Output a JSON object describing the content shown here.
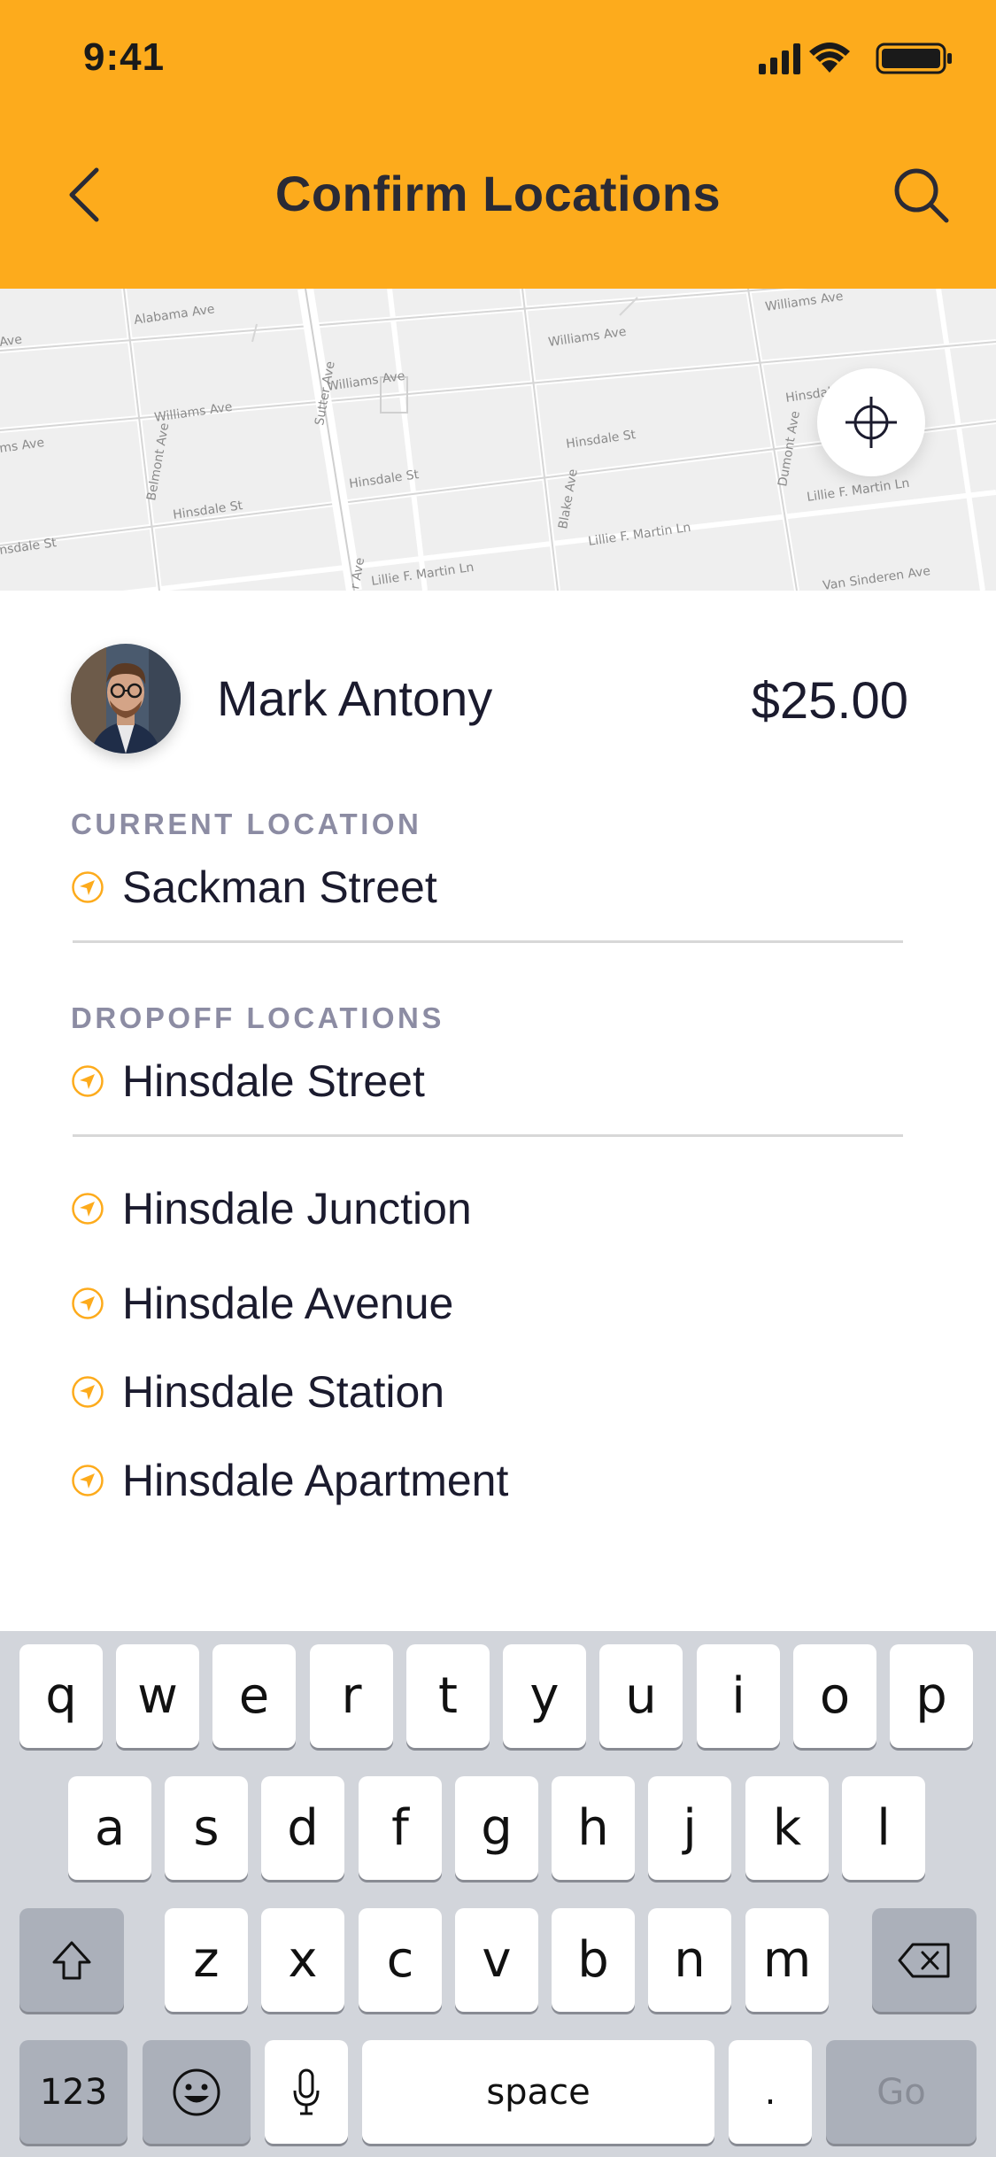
{
  "status_bar": {
    "time": "9:41"
  },
  "header": {
    "title": "Confirm Locations",
    "back_icon": "chevron-left-icon",
    "search_icon": "search-icon"
  },
  "colors": {
    "accent": "#FDAB1C",
    "text": "#1b1b2e",
    "label": "#8c8ca3",
    "keyboard_bg": "#d2d5db"
  },
  "map": {
    "street_labels": [
      "Alabama Ave",
      "Williams Ave",
      "Williams Ave",
      "Williams Ave",
      "Williams Ave",
      "Sutter Ave",
      "Belmont Ave",
      "Hinsdale St",
      "Hinsdale St",
      "Hinsdale St",
      "Hinsdale St",
      "Hinsdale",
      "Blake Ave",
      "Dumont Ave",
      "Lillie F. Martin Ln",
      "Lillie F. Martin Ln",
      "Lillie F. Martin Ln",
      "Van Sinderen Ave",
      "Ave",
      "ms Ave",
      "nsdale St",
      "r Ave"
    ]
  },
  "driver": {
    "name": "Mark Antony",
    "price": "$25.00"
  },
  "current_location": {
    "label": "CURRENT LOCATION",
    "value": "Sackman Street"
  },
  "dropoff": {
    "label": "DROPOFF LOCATIONS",
    "input_value": "Hinsdale Street",
    "suggestions": [
      "Hinsdale Junction",
      "Hinsdale Avenue",
      "Hinsdale Station",
      "Hinsdale Apartment"
    ]
  },
  "keyboard": {
    "row1": [
      "q",
      "w",
      "e",
      "r",
      "t",
      "y",
      "u",
      "i",
      "o",
      "p"
    ],
    "row2": [
      "a",
      "s",
      "d",
      "f",
      "g",
      "h",
      "j",
      "k",
      "l"
    ],
    "row3": [
      "z",
      "x",
      "c",
      "v",
      "b",
      "n",
      "m"
    ],
    "numbers_label": "123",
    "space_label": "space",
    "period_label": ".",
    "go_label": "Go"
  }
}
